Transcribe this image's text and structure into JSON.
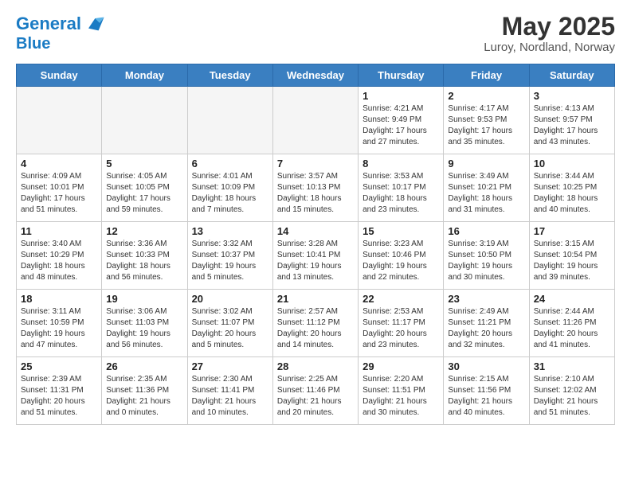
{
  "header": {
    "logo_line1": "General",
    "logo_line2": "Blue",
    "title": "May 2025",
    "subtitle": "Luroy, Nordland, Norway"
  },
  "weekdays": [
    "Sunday",
    "Monday",
    "Tuesday",
    "Wednesday",
    "Thursday",
    "Friday",
    "Saturday"
  ],
  "weeks": [
    [
      {
        "day": "",
        "info": ""
      },
      {
        "day": "",
        "info": ""
      },
      {
        "day": "",
        "info": ""
      },
      {
        "day": "",
        "info": ""
      },
      {
        "day": "1",
        "info": "Sunrise: 4:21 AM\nSunset: 9:49 PM\nDaylight: 17 hours\nand 27 minutes."
      },
      {
        "day": "2",
        "info": "Sunrise: 4:17 AM\nSunset: 9:53 PM\nDaylight: 17 hours\nand 35 minutes."
      },
      {
        "day": "3",
        "info": "Sunrise: 4:13 AM\nSunset: 9:57 PM\nDaylight: 17 hours\nand 43 minutes."
      }
    ],
    [
      {
        "day": "4",
        "info": "Sunrise: 4:09 AM\nSunset: 10:01 PM\nDaylight: 17 hours\nand 51 minutes."
      },
      {
        "day": "5",
        "info": "Sunrise: 4:05 AM\nSunset: 10:05 PM\nDaylight: 17 hours\nand 59 minutes."
      },
      {
        "day": "6",
        "info": "Sunrise: 4:01 AM\nSunset: 10:09 PM\nDaylight: 18 hours\nand 7 minutes."
      },
      {
        "day": "7",
        "info": "Sunrise: 3:57 AM\nSunset: 10:13 PM\nDaylight: 18 hours\nand 15 minutes."
      },
      {
        "day": "8",
        "info": "Sunrise: 3:53 AM\nSunset: 10:17 PM\nDaylight: 18 hours\nand 23 minutes."
      },
      {
        "day": "9",
        "info": "Sunrise: 3:49 AM\nSunset: 10:21 PM\nDaylight: 18 hours\nand 31 minutes."
      },
      {
        "day": "10",
        "info": "Sunrise: 3:44 AM\nSunset: 10:25 PM\nDaylight: 18 hours\nand 40 minutes."
      }
    ],
    [
      {
        "day": "11",
        "info": "Sunrise: 3:40 AM\nSunset: 10:29 PM\nDaylight: 18 hours\nand 48 minutes."
      },
      {
        "day": "12",
        "info": "Sunrise: 3:36 AM\nSunset: 10:33 PM\nDaylight: 18 hours\nand 56 minutes."
      },
      {
        "day": "13",
        "info": "Sunrise: 3:32 AM\nSunset: 10:37 PM\nDaylight: 19 hours\nand 5 minutes."
      },
      {
        "day": "14",
        "info": "Sunrise: 3:28 AM\nSunset: 10:41 PM\nDaylight: 19 hours\nand 13 minutes."
      },
      {
        "day": "15",
        "info": "Sunrise: 3:23 AM\nSunset: 10:46 PM\nDaylight: 19 hours\nand 22 minutes."
      },
      {
        "day": "16",
        "info": "Sunrise: 3:19 AM\nSunset: 10:50 PM\nDaylight: 19 hours\nand 30 minutes."
      },
      {
        "day": "17",
        "info": "Sunrise: 3:15 AM\nSunset: 10:54 PM\nDaylight: 19 hours\nand 39 minutes."
      }
    ],
    [
      {
        "day": "18",
        "info": "Sunrise: 3:11 AM\nSunset: 10:59 PM\nDaylight: 19 hours\nand 47 minutes."
      },
      {
        "day": "19",
        "info": "Sunrise: 3:06 AM\nSunset: 11:03 PM\nDaylight: 19 hours\nand 56 minutes."
      },
      {
        "day": "20",
        "info": "Sunrise: 3:02 AM\nSunset: 11:07 PM\nDaylight: 20 hours\nand 5 minutes."
      },
      {
        "day": "21",
        "info": "Sunrise: 2:57 AM\nSunset: 11:12 PM\nDaylight: 20 hours\nand 14 minutes."
      },
      {
        "day": "22",
        "info": "Sunrise: 2:53 AM\nSunset: 11:17 PM\nDaylight: 20 hours\nand 23 minutes."
      },
      {
        "day": "23",
        "info": "Sunrise: 2:49 AM\nSunset: 11:21 PM\nDaylight: 20 hours\nand 32 minutes."
      },
      {
        "day": "24",
        "info": "Sunrise: 2:44 AM\nSunset: 11:26 PM\nDaylight: 20 hours\nand 41 minutes."
      }
    ],
    [
      {
        "day": "25",
        "info": "Sunrise: 2:39 AM\nSunset: 11:31 PM\nDaylight: 20 hours\nand 51 minutes."
      },
      {
        "day": "26",
        "info": "Sunrise: 2:35 AM\nSunset: 11:36 PM\nDaylight: 21 hours\nand 0 minutes."
      },
      {
        "day": "27",
        "info": "Sunrise: 2:30 AM\nSunset: 11:41 PM\nDaylight: 21 hours\nand 10 minutes."
      },
      {
        "day": "28",
        "info": "Sunrise: 2:25 AM\nSunset: 11:46 PM\nDaylight: 21 hours\nand 20 minutes."
      },
      {
        "day": "29",
        "info": "Sunrise: 2:20 AM\nSunset: 11:51 PM\nDaylight: 21 hours\nand 30 minutes."
      },
      {
        "day": "30",
        "info": "Sunrise: 2:15 AM\nSunset: 11:56 PM\nDaylight: 21 hours\nand 40 minutes."
      },
      {
        "day": "31",
        "info": "Sunrise: 2:10 AM\nSunset: 12:02 AM\nDaylight: 21 hours\nand 51 minutes."
      }
    ]
  ]
}
